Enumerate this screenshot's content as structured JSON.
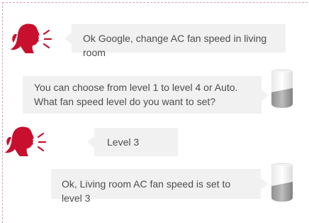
{
  "accent_color": "#c8102e",
  "conversation": [
    {
      "speaker": "user",
      "text": "Ok Google, change AC fan speed in living room"
    },
    {
      "speaker": "assistant",
      "lines": [
        "You can choose from level 1 to level 4 or Auto.",
        "What fan speed level  do you want to set?"
      ]
    },
    {
      "speaker": "user",
      "text": "Level 3"
    },
    {
      "speaker": "assistant",
      "text": "Ok, Living room AC fan speed is set to  level 3"
    }
  ],
  "icons": {
    "user": "person-speaking-icon",
    "assistant": "smart-speaker-icon"
  }
}
